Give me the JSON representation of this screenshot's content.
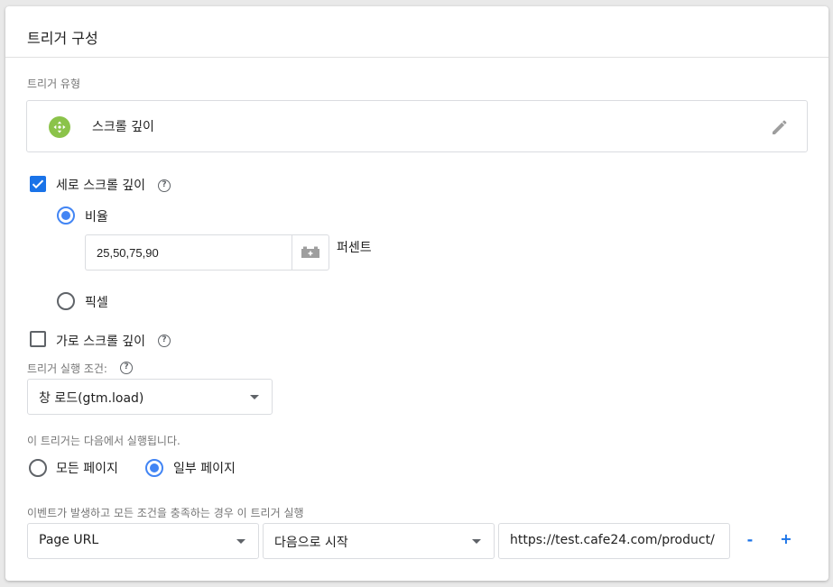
{
  "header": {
    "title": "트리거 구성"
  },
  "trigger_type": {
    "label": "트리거 유형",
    "name": "스크롤 깊이",
    "icon": "scroll-move-icon",
    "icon_color": "#8bc34a"
  },
  "vertical": {
    "label": "세로 스크롤 깊이",
    "checked": true,
    "options": {
      "percent_label": "비율",
      "pixel_label": "픽셀"
    },
    "percent_value": "25,50,75,90",
    "unit_label": "퍼센트"
  },
  "horizontal": {
    "label": "가로 스크롤 깊이",
    "checked": false
  },
  "fire_on": {
    "label": "트리거 실행 조건:",
    "selected": "창 로드(gtm.load)"
  },
  "scope": {
    "label": "이 트리거는 다음에서 실행됩니다.",
    "all_pages": "모든 페이지",
    "some_pages": "일부 페이지",
    "selected": "some_pages"
  },
  "condition": {
    "label": "이벤트가 발생하고 모든 조건을 충족하는 경우 이 트리거 실행",
    "variable": "Page URL",
    "operator": "다음으로 시작",
    "value": "https://test.cafe24.com/product/",
    "remove_label": "-",
    "add_label": "+"
  },
  "colors": {
    "accent": "#1a73e8",
    "radio": "#4285f4"
  }
}
